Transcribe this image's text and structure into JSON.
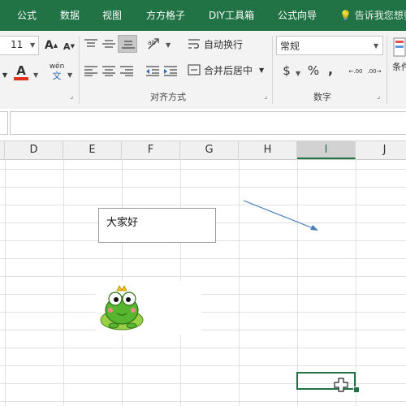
{
  "ribbon_tabs": [
    "公式",
    "数据",
    "视图",
    "方方格子",
    "DIY工具箱",
    "公式向导"
  ],
  "tell_me": "告诉我您想要",
  "font": {
    "size": "11",
    "grow_icon": "A",
    "shrink_icon": "A",
    "font_color_icon": "A",
    "phonetic_top": "wén",
    "phonetic_bottom": "文"
  },
  "alignment": {
    "wrap_text": "自动换行",
    "merge_center": "合并后居中",
    "group_label": "对齐方式"
  },
  "number": {
    "format": "常规",
    "currency": "$",
    "percent": "%",
    "comma": ",",
    "inc_decimal": "←.00",
    "dec_decimal": ".00→",
    "group_label": "数字"
  },
  "styles": {
    "conditional_partial": "条件"
  },
  "columns": [
    "D",
    "E",
    "F",
    "G",
    "H",
    "I",
    "J"
  ],
  "selected_column": "I",
  "textbox_text": "大家好",
  "colors": {
    "ribbon_green": "#217346",
    "arrow_blue": "#4a7ebb",
    "frog_green": "#58b52f",
    "font_color_red": "#e0301e"
  }
}
